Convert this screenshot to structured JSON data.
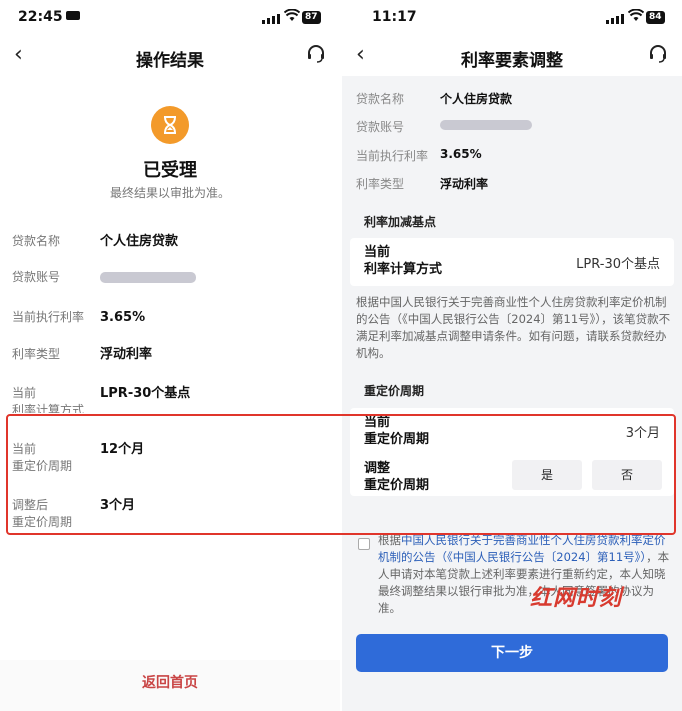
{
  "left": {
    "status": {
      "time": "22:45",
      "battery": "87"
    },
    "nav": {
      "title": "操作结果"
    },
    "result": {
      "title": "已受理",
      "subtitle": "最终结果以审批为准。"
    },
    "rows": [
      {
        "label": "贷款名称",
        "value": "个人住房贷款"
      },
      {
        "label": "贷款账号",
        "value": ""
      },
      {
        "label": "当前执行利率",
        "value": "3.65%"
      },
      {
        "label": "利率类型",
        "value": "浮动利率"
      },
      {
        "label": "当前\n利率计算方式",
        "value": "LPR-30个基点"
      },
      {
        "label": "当前\n重定价周期",
        "value": "12个月"
      },
      {
        "label": "调整后\n重定价周期",
        "value": "3个月"
      }
    ],
    "home_link": "返回首页"
  },
  "right": {
    "status": {
      "time": "11:17",
      "battery": "84"
    },
    "nav": {
      "title": "利率要素调整"
    },
    "info": [
      {
        "label": "贷款名称",
        "value": "个人住房贷款"
      },
      {
        "label": "贷款账号",
        "value": ""
      },
      {
        "label": "当前执行利率",
        "value": "3.65%"
      },
      {
        "label": "利率类型",
        "value": "浮动利率"
      }
    ],
    "section_basis": "利率加减基点",
    "current_method": {
      "label": "当前\n利率计算方式",
      "value": "LPR-30个基点"
    },
    "basis_notice": "根据中国人民银行关于完善商业性个人住房贷款利率定价机制的公告（《中国人民银行公告〔2024〕第11号》），该笔贷款不满足利率加减基点调整申请条件。如有问题，请联系贷款经办机构。",
    "section_period": "重定价周期",
    "current_period": {
      "label": "当前\n重定价周期",
      "value": "3个月"
    },
    "adjust_period": {
      "label": "调整\n重定价周期",
      "yes": "是",
      "no": "否"
    },
    "agreement": {
      "prefix": "根据",
      "link": "中国人民银行关于完善商业性个人住房贷款利率定价机制的公告（《中国人民银行公告〔2024〕第11号》）",
      "rest": "，本人申请对本笔贷款上述利率要素进行重新约定，本人知晓最终调整结果以银行审批为准，本人同意签署的协议为准。"
    },
    "watermark": "红网时刻",
    "next_button": "下一步"
  },
  "colors": {
    "highlight": "#e0352b",
    "primary": "#2f6bd9",
    "icon_orange": "#f39a2a",
    "link_red": "#c94545"
  }
}
